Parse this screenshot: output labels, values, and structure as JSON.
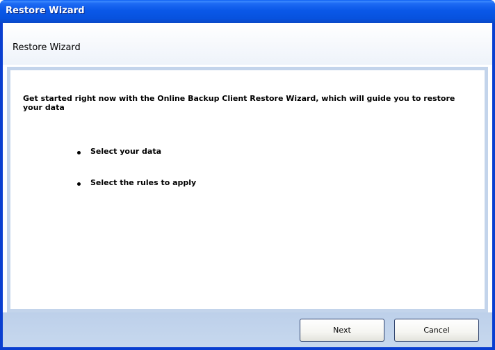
{
  "window": {
    "title": "Restore Wizard"
  },
  "header": {
    "title": "Restore Wizard"
  },
  "content": {
    "intro": "Get started right now with the Online Backup Client Restore Wizard, which will guide you to restore your data",
    "steps": [
      {
        "label": "Select your data"
      },
      {
        "label": "Select the rules to apply"
      }
    ]
  },
  "footer": {
    "next_label": "Next",
    "cancel_label": "Cancel"
  },
  "colors": {
    "titlebar": "#0a58e8",
    "frame_border": "#c3d4eb",
    "footer_band": "#c7d8ee"
  }
}
